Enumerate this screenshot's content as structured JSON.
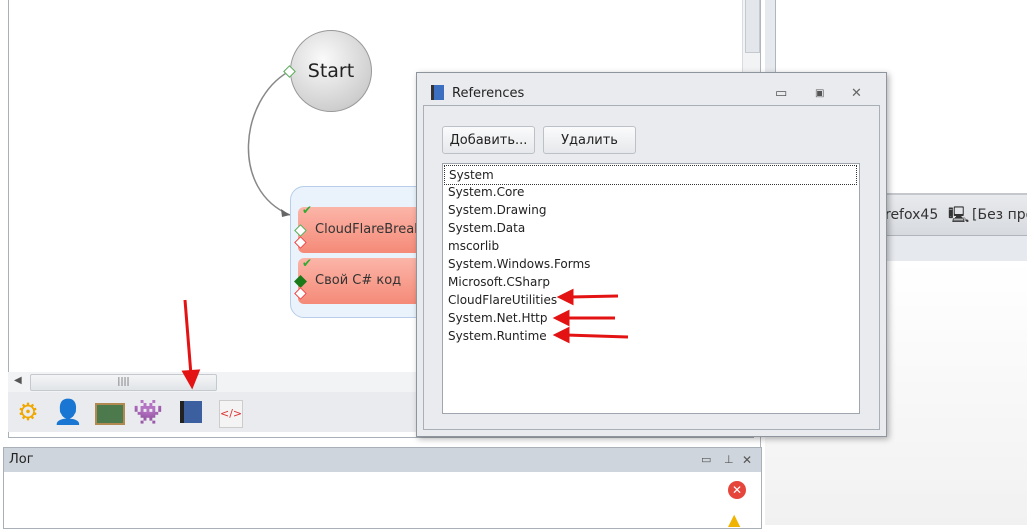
{
  "workflow": {
    "start_label": "Start",
    "nodes": [
      {
        "label": "CloudFlareBreak"
      },
      {
        "label": "Свой C# код"
      }
    ]
  },
  "toolbar": {
    "icons": [
      "settings-icon",
      "user-icon",
      "chalkboard-icon",
      "monster-icon",
      "references-books-icon",
      "code-document-icon"
    ]
  },
  "right_panel": {
    "tab_text": "refox45",
    "profile_text": "[Без про"
  },
  "log": {
    "title": "Лог"
  },
  "dialog": {
    "title": "References",
    "add_label": "Добавить...",
    "remove_label": "Удалить",
    "references": [
      "System",
      "System.Core",
      "System.Drawing",
      "System.Data",
      "mscorlib",
      "System.Windows.Forms",
      "Microsoft.CSharp",
      "CloudFlareUtilities",
      "System.Net.Http",
      "System.Runtime"
    ],
    "selected": "System"
  },
  "colors": {
    "annotation_arrow": "#e41313",
    "node": "#f58a78"
  }
}
